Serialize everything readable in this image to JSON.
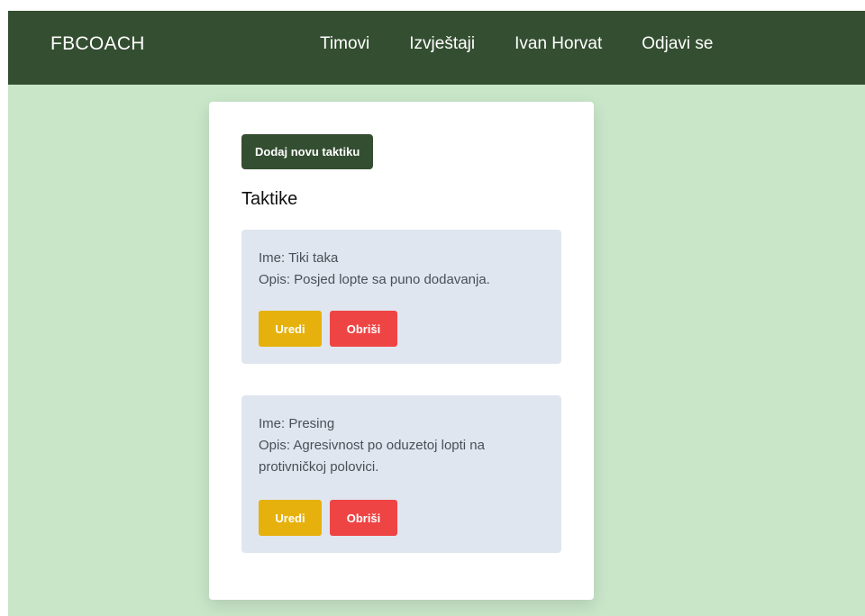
{
  "navbar": {
    "brand": "FBCOACH",
    "links": [
      "Timovi",
      "Izvještaji",
      "Ivan Horvat",
      "Odjavi se"
    ]
  },
  "main": {
    "add_button": "Dodaj novu taktiku",
    "section_title": "Taktike",
    "tactics": [
      {
        "name": "Ime: Tiki taka",
        "description": "Opis: Posjed lopte sa puno dodavanja.",
        "edit_label": "Uredi",
        "delete_label": "Obriši"
      },
      {
        "name": "Ime: Presing",
        "description": "Opis: Agresivnost po oduzetoj lopti na protivničkoj polovici.",
        "edit_label": "Uredi",
        "delete_label": "Obriši"
      }
    ]
  },
  "colors": {
    "navbar": "#344e31",
    "background": "#c9e6c9",
    "tactic_card": "#e0e6ef",
    "edit": "#e6b10c",
    "delete": "#ef4444"
  }
}
